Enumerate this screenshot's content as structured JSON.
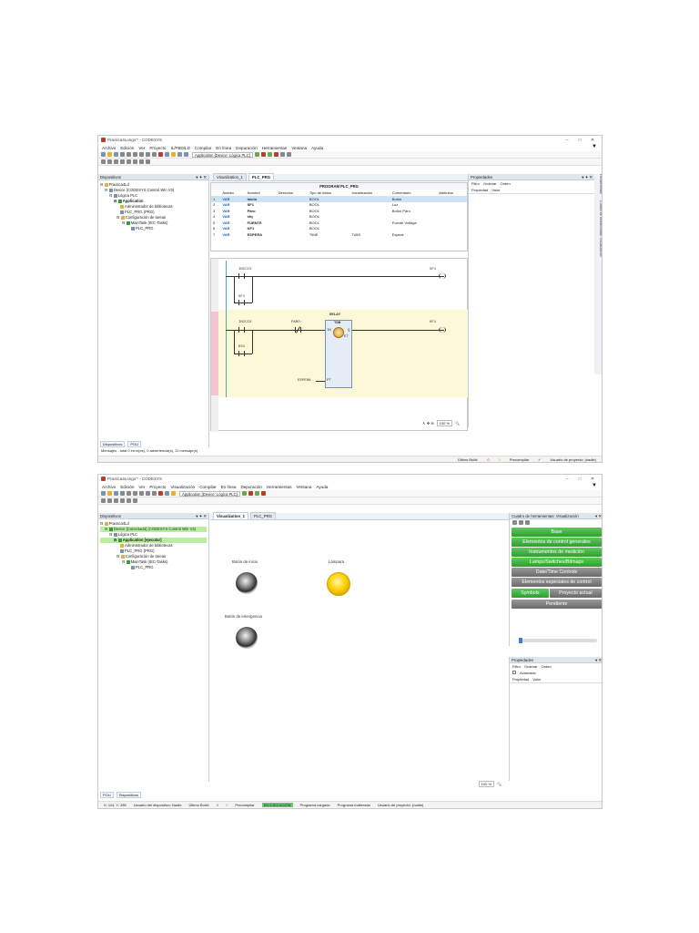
{
  "shot1": {
    "window_title": "Practica4Longo’* - CODESYS",
    "menu": [
      "Archivo",
      "Edición",
      "Ver",
      "Proyecto",
      "IL/FBD/LD",
      "Compilar",
      "En línea",
      "Depuración",
      "Herramientas",
      "Ventana",
      "Ayuda"
    ],
    "toolbar_selector": "Application [Device: Lógica PLC]",
    "devices_panel_title": "Dispositivos",
    "tree": [
      "Practica4Ld",
      "Device (CODESYS Control Win V3)",
      "Lógica PLC",
      "Application",
      "Administrador de bibliotecas",
      "PLC_PRG (PRG)",
      "Configuración de tareas",
      "MainTask (IEC-Tasks)",
      "PLC_PRG"
    ],
    "tabs": [
      "Visualization_1",
      "PLC_PRG"
    ],
    "program_title": "PROGRAM PLC_PRG",
    "decl_headers": [
      "Ámbito",
      "Nombre",
      "Dirección",
      "Tipo de datos",
      "Inicialización",
      "Comentario",
      "Atributos"
    ],
    "decl_rows": [
      {
        "n": "1",
        "scope": "VAR",
        "name": "Inicio",
        "type": "BOOL",
        "init": "",
        "comment": "Botón"
      },
      {
        "n": "2",
        "scope": "VAR",
        "name": "SF1",
        "type": "BOOL",
        "init": "",
        "comment": "Luz"
      },
      {
        "n": "3",
        "scope": "VAR",
        "name": "Paro",
        "type": "BOOL",
        "init": "",
        "comment": "Botón Paro"
      },
      {
        "n": "4",
        "scope": "VAR",
        "name": "sfq",
        "type": "BOOL",
        "init": "",
        "comment": ""
      },
      {
        "n": "5",
        "scope": "VAR",
        "name": "FUENTE",
        "type": "BOOL",
        "init": "",
        "comment": "Fuente Voltage"
      },
      {
        "n": "6",
        "scope": "VAR",
        "name": "KF1",
        "type": "BOOL",
        "init": "",
        "comment": ""
      },
      {
        "n": "7",
        "scope": "VAR",
        "name": "ESPERA",
        "type": "TIME",
        "init": "T#5S",
        "comment": "Espera"
      }
    ],
    "rung1": {
      "c1": "INICIO",
      "c2": "SF1",
      "coil": "SF1"
    },
    "rung2": {
      "block": "DELAY",
      "fb": "TON",
      "c1": "INICIO",
      "c2": "PARO",
      "c3": "KS1",
      "coil": "KF1",
      "in": "IN",
      "q": "Q",
      "et": "ET",
      "pt": "PT",
      "pt_var": "ESPERA"
    },
    "zoom": "100 %",
    "props_title": "Propiedades",
    "props_toolbar": [
      "Filtro",
      "Ordenar",
      "Orden"
    ],
    "props_cols": [
      "Propiedad",
      "Valor"
    ],
    "side_tabs": [
      "Herramientas",
      "Cuadro de herramientas: Visualización"
    ],
    "bottom_tabs": [
      "Dispositivos",
      "POU"
    ],
    "messages": "Mensajes - total 0 error(es), 0 advertencia(s), 11 mensaje(s)",
    "status": {
      "build": "Último Build:",
      "e": "0",
      "w": "0",
      "precompile": "Precompilar",
      "user": "Usuario de proyecto: (nadie)"
    }
  },
  "shot2": {
    "window_title": "Practica4Longo’* - CODESYS",
    "menu": [
      "Archivo",
      "Edición",
      "Ver",
      "Proyecto",
      "Visualización",
      "Compilar",
      "En línea",
      "Depuración",
      "Herramientas",
      "Ventana",
      "Ayuda"
    ],
    "toolbar_selector": "Application [Device: Lógica PLC]",
    "devices_panel_title": "Dispositivos",
    "tree": [
      "Practica4Ld",
      "Device [Conectado] (CODESYS Control Win V3)",
      "Lógica PLC",
      "Application [ejecutar]",
      "Administrador de bibliotecas",
      "PLC_PRG (PRG)",
      "Configuración de tareas",
      "MainTask (IEC-Tasks)",
      "PLC_PRG"
    ],
    "tabs": [
      "Visualization_1",
      "PLC_PRG"
    ],
    "visu": {
      "start_label": "Botón de inicio",
      "lamp_label": "Lámpara",
      "emergency_label": "Botón de emergencia"
    },
    "zoom": "100 %",
    "toolbox_title": "Cuadro de herramientas: Visualización",
    "toolbox_buttons": [
      {
        "label": "Base",
        "style": "gr"
      },
      {
        "label": "Elementos de control generales",
        "style": "gr"
      },
      {
        "label": "Instrumentos de medición",
        "style": "gr"
      },
      {
        "label": "Lamps/Switches/Bitmaps",
        "style": "gr"
      },
      {
        "label": "Date/Time Controls",
        "style": "gy"
      },
      {
        "label": "Elementos especiales de control",
        "style": "gy"
      }
    ],
    "toolbox_split": [
      "Symbols",
      "Proyecto actual"
    ],
    "toolbox_last": "Pendiente",
    "props_title": "Propiedades",
    "props_toolbar": [
      "Filtro",
      "Ordenar",
      "Orden"
    ],
    "props_advanced": "Avanzado",
    "props_cols": [
      "Propiedad",
      "Valor"
    ],
    "bottom_tabs": [
      "POU",
      "Dispositivos"
    ],
    "status": {
      "coords": "X: 114, Y: 289",
      "device_user": "Usuario del dispositivo: Nadie",
      "build": "Último Build:",
      "e": "0",
      "w": "0",
      "precompile": "Precompilar",
      "run": "EN EJECUCIÓN",
      "loaded": "Programa cargado",
      "unchanged": "Programa inalterado",
      "user": "Usuario de proyecto: (nadie)"
    }
  }
}
